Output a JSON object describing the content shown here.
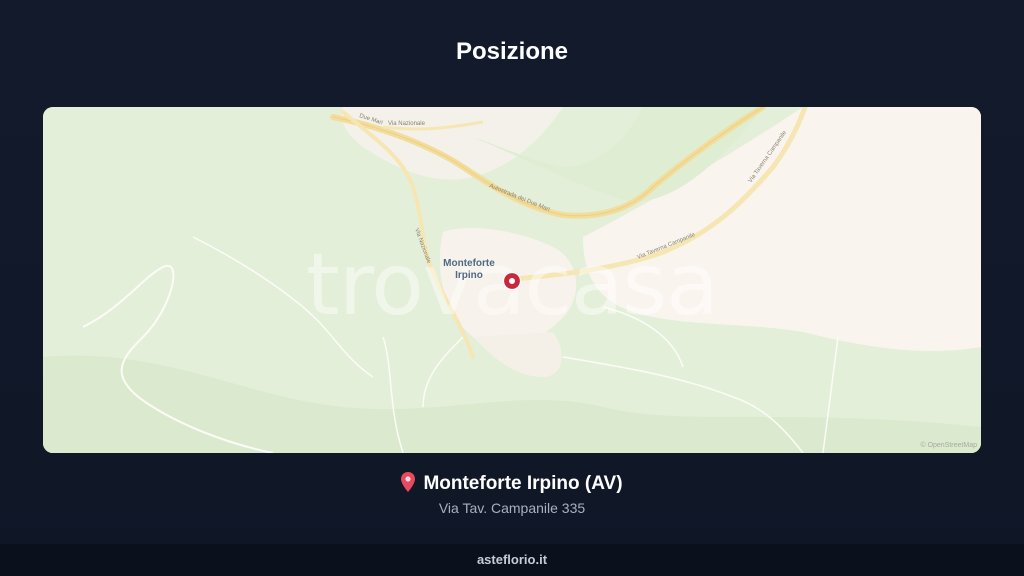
{
  "header": {
    "title": "Posizione"
  },
  "map": {
    "town_label": "Monteforte Irpino",
    "watermark": "trovacasa",
    "attribution": "© OpenStreetMap",
    "road_labels": [
      "Due Mari",
      "Via Nazionale",
      "Autostrada dei Due Mari",
      "Via Taverna Campanile",
      "Via Taverna Campanile",
      "Via Nazionale"
    ],
    "colors": {
      "land": "#e3efd9",
      "urban": "#f9f5ee",
      "road": "#f3dd9b",
      "marker": "#c8283a"
    }
  },
  "location": {
    "name": "Monteforte Irpino (AV)",
    "address": "Via Tav. Campanile 335"
  },
  "footer": {
    "brand": "asteflorio.it"
  }
}
